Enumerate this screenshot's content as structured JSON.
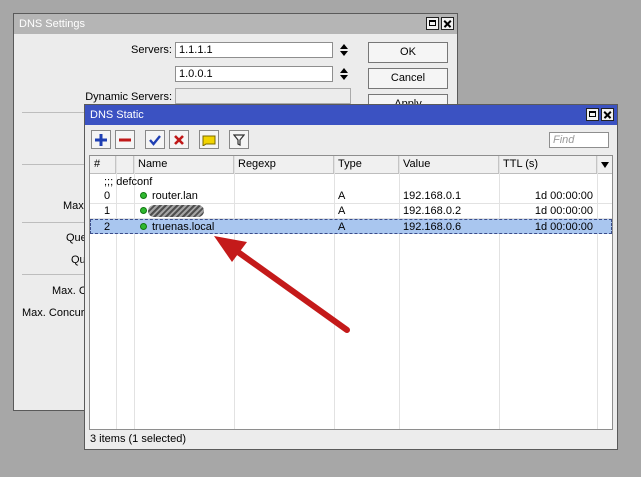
{
  "settings": {
    "title": "DNS Settings",
    "servers_label": "Servers:",
    "server1": "1.1.1.1",
    "server2": "1.0.0.1",
    "dynamic_servers_label": "Dynamic Servers:",
    "ok_label": "OK",
    "cancel_label": "Cancel",
    "apply_label": "Apply",
    "partial_labels": [
      "Max",
      "Que",
      "Qu",
      "Max. C",
      "Max. Concurr"
    ]
  },
  "static": {
    "title": "DNS Static",
    "find_placeholder": "Find",
    "columns": [
      "#",
      "Name",
      "Regexp",
      "Type",
      "Value",
      "TTL (s)"
    ],
    "comment": ";;; defconf",
    "rows": [
      {
        "num": "0",
        "name": "router.lan",
        "regexp": "",
        "type": "A",
        "value": "192.168.0.1",
        "ttl": "1d 00:00:00"
      },
      {
        "num": "1",
        "name": "",
        "regexp": "",
        "type": "A",
        "value": "192.168.0.2",
        "ttl": "1d 00:00:00"
      },
      {
        "num": "2",
        "name": "truenas.local",
        "regexp": "",
        "type": "A",
        "value": "192.168.0.6",
        "ttl": "1d 00:00:00"
      }
    ],
    "selected_row": 2,
    "status": "3 items (1 selected)"
  },
  "colors": {
    "active_title": "#3b52c2",
    "inactive_title": "#b5b5b5",
    "selection": "#a9c6ef",
    "arrow": "#c41a1a",
    "enabled_dot": "#2fb82f"
  }
}
